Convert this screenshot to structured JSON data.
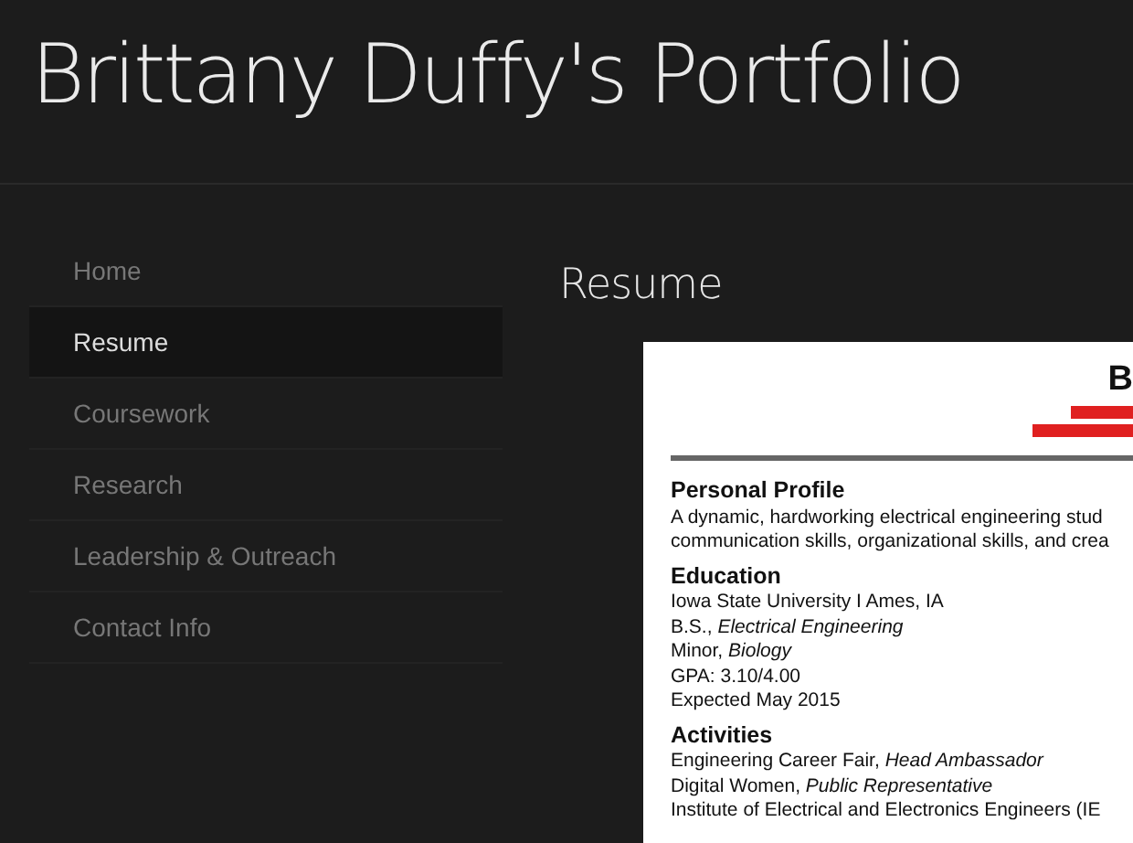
{
  "site_title": "Brittany Duffy's Portfolio",
  "nav": [
    {
      "label": "Home",
      "selected": false
    },
    {
      "label": "Resume",
      "selected": true
    },
    {
      "label": "Coursework",
      "selected": false
    },
    {
      "label": "Research",
      "selected": false
    },
    {
      "label": "Leadership & Outreach",
      "selected": false
    },
    {
      "label": "Contact Info",
      "selected": false
    }
  ],
  "page_heading": "Resume",
  "document": {
    "name_initial": "B",
    "sections": [
      {
        "heading": "Personal Profile",
        "lines": [
          "A dynamic, hardworking electrical engineering stud",
          "communication skills, organizational skills, and crea"
        ]
      },
      {
        "heading": "Education",
        "lines": [
          "Iowa State University I Ames, IA",
          "B.S., *Electrical Engineering*",
          "Minor, *Biology*",
          "GPA: 3.10/4.00",
          "Expected May 2015"
        ]
      },
      {
        "heading": "Activities",
        "lines": [
          "Engineering Career Fair, *Head Ambassador*",
          "Digital Women, *Public Representative*",
          "Institute of Electrical and Electronics Engineers (IE"
        ]
      }
    ]
  }
}
